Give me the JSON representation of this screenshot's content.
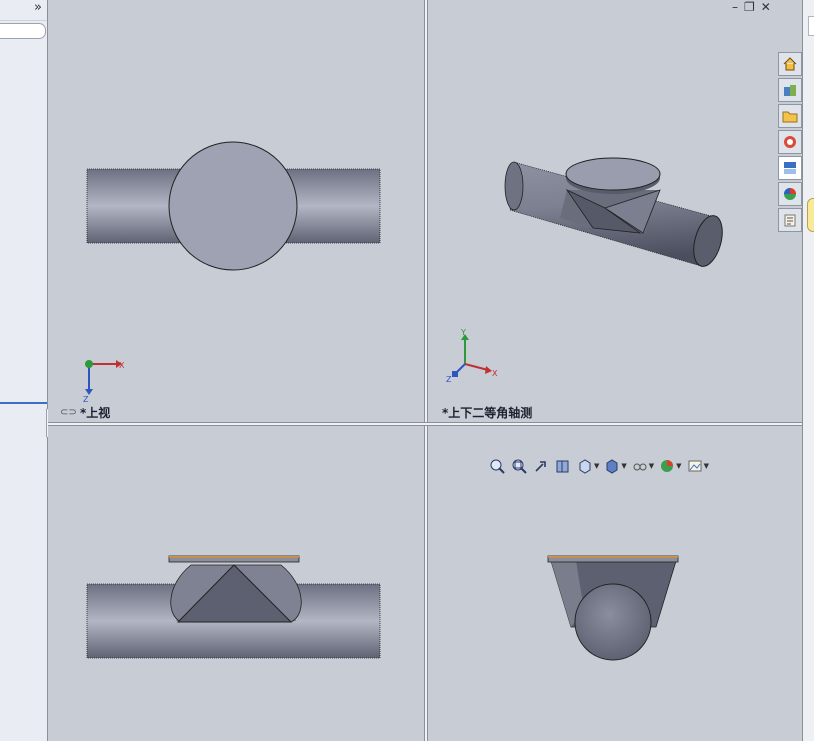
{
  "left_panel": {
    "collapse_label": "»"
  },
  "views": {
    "top": {
      "label": "*上视"
    },
    "iso": {
      "label": "*上下二等角轴测"
    }
  },
  "axes": {
    "x": "X",
    "y": "Y",
    "z": "Z"
  },
  "window_controls": {
    "minimize": "–",
    "restore": "❐",
    "close": "✕"
  },
  "taskpane_icons": [
    "home-icon",
    "library-icon",
    "folder-icon",
    "view-palette-icon",
    "appearance-icon",
    "color-icon",
    "custom-properties-icon"
  ],
  "toolbar_icons": [
    "zoom-fit-icon",
    "zoom-area-icon",
    "previous-view-icon",
    "section-view-icon",
    "view-orientation-icon",
    "display-style-icon",
    "hide-show-icon",
    "edit-appearance-icon",
    "apply-scene-icon"
  ]
}
